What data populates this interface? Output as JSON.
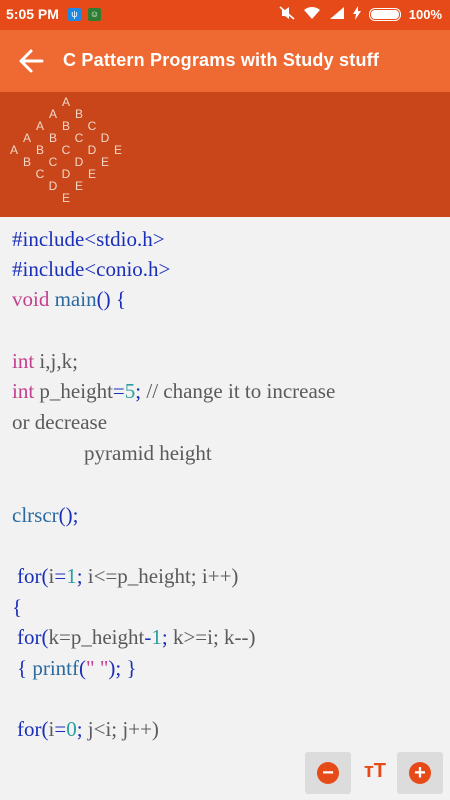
{
  "status_bar": {
    "time": "5:05 PM",
    "battery": "100%",
    "battery_level": 1.0
  },
  "app_bar": {
    "title": "C Pattern Programs with Study stuff",
    "back_icon": "arrow-left-icon"
  },
  "banner": {
    "pattern_rows": [
      [
        "A"
      ],
      [
        "A",
        "B"
      ],
      [
        "A",
        "B",
        "C"
      ],
      [
        "A",
        "B",
        "C",
        "D"
      ],
      [
        "A",
        "B",
        "C",
        "D",
        "E"
      ],
      [
        "B",
        "C",
        "D",
        "E"
      ],
      [
        "C",
        "D",
        "E"
      ],
      [
        "D",
        "E"
      ],
      [
        "E"
      ]
    ]
  },
  "code": {
    "l1": "#include<stdio.h>",
    "l2": "#include<conio.h>",
    "l3_kw": "void",
    "l3_fn": "main",
    "l3_rest": "() {",
    "l5_kw": "int",
    "l5_rest": "i,j,k;",
    "l6_kw": "int",
    "l6_var": "p_height",
    "l6_eq": "=",
    "l6_num": "5",
    "l6_semi": ";",
    "l6_comment": "// change it to increase",
    "l7": "or decrease",
    "l8": "pyramid height",
    "l10_fn": "clrscr",
    "l10_rest": "();",
    "l12_for": "for",
    "l12_p1": "(",
    "l12_i": "i",
    "l12_eq": "=",
    "l12_one": "1",
    "l12_semi": ";",
    "l12_cond": "i<=p_height;",
    "l12_inc": "i++)",
    "l13": "{",
    "l14_for": "for",
    "l14_p1": "(",
    "l14_a": "k=p_height",
    "l14_minus": "-",
    "l14_one": "1",
    "l14_semi": ";",
    "l14_cond": "k>=i;",
    "l14_dec": "k--)",
    "l15_open": "{",
    "l15_fn": "printf",
    "l15_p": "(",
    "l15_str": "\" \"",
    "l15_close": "); }",
    "l17_for": "for",
    "l17_p1": "(",
    "l17_i": "i",
    "l17_eq": "=",
    "l17_zero": "0",
    "l17_semi": ";",
    "l17_cond": "j<i;",
    "l17_inc": "j++)"
  },
  "font_controls": {
    "decrease_icon": "minus-circle-icon",
    "size_label": "тT",
    "increase_icon": "plus-circle-icon"
  },
  "colors": {
    "status_bar": "#e64a19",
    "app_bar": "#ef6a32",
    "banner": "#c8461a",
    "code_bg": "#f2f2f2"
  }
}
